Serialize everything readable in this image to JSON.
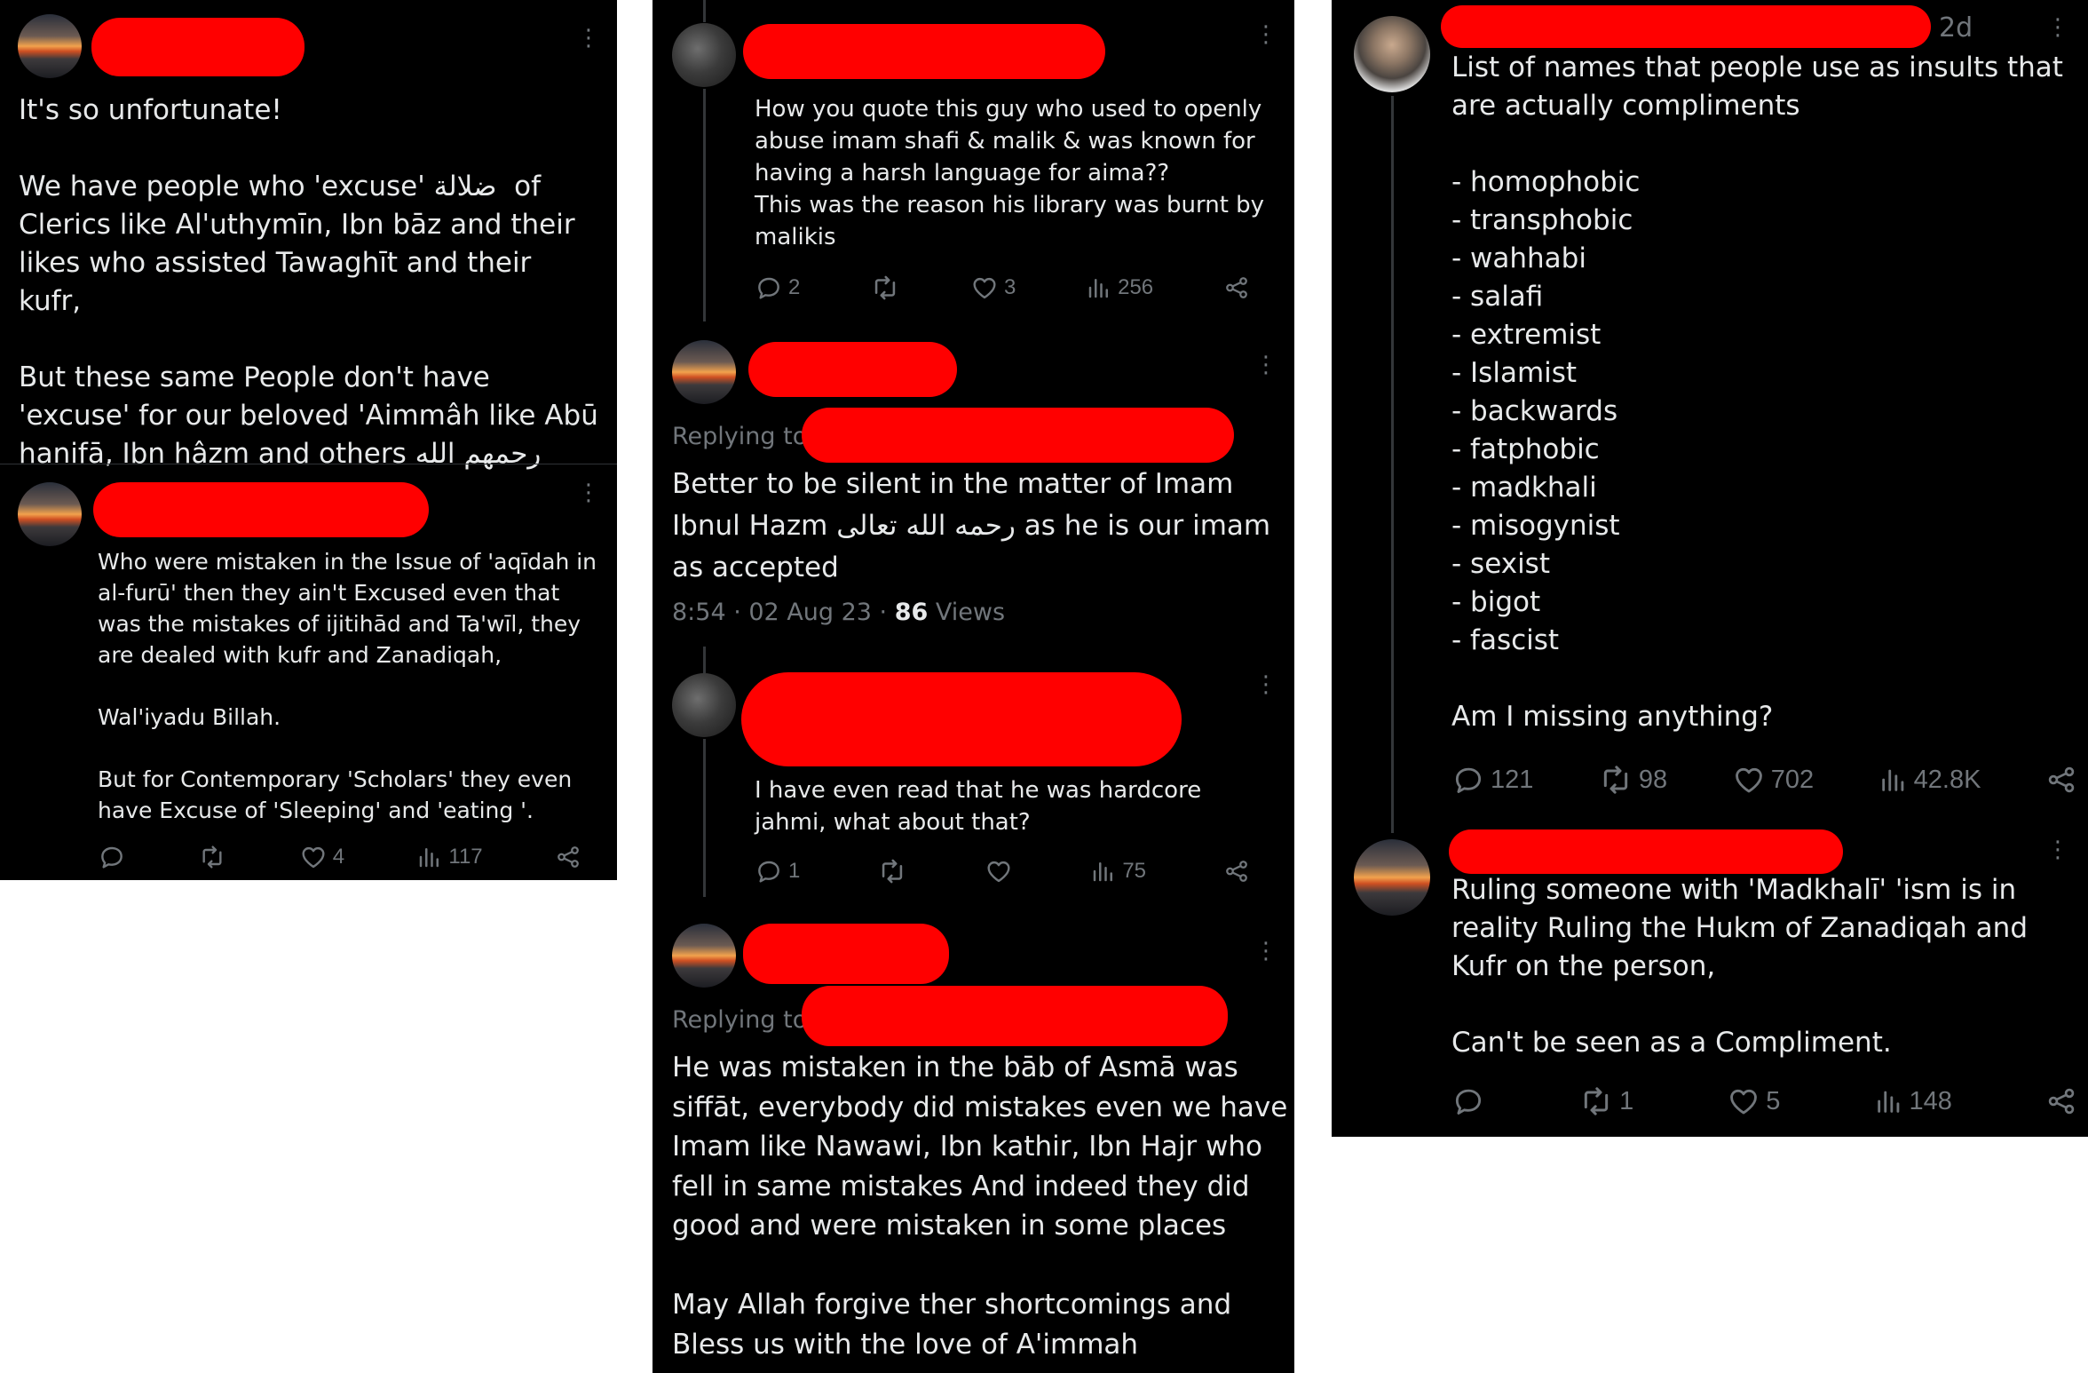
{
  "panel1": {
    "tweet1": {
      "text": "It's so unfortunate!\n\nWe have people who 'excuse' ضلالة  of Clerics like Al'uthymīn, Ibn bāz and their likes who assisted Tawaghīt and their kufr,\n\nBut these same People don't have 'excuse' for our beloved 'Aimmâh like Abū hanifā, Ibn hâzm and others رحمهم الله"
    },
    "tweet2": {
      "text": "Who were mistaken in the Issue of 'aqīdah in al-furū' then they ain't Excused even that was the mistakes of ijitihād and Ta'wīl, they are dealed with kufr and Zanadiqah,\n\nWal'iyadu Billah.\n\nBut for Contemporary 'Scholars' they even have Excuse of 'Sleeping' and 'eating '.",
      "likes": "4",
      "views": "117"
    }
  },
  "panel2": {
    "reply1": {
      "text": "How you quote this guy who used to openly abuse imam shafi & malik & was known for having a harsh language for aima??\nThis was the reason his library was burnt by malikis",
      "replies": "2",
      "likes": "3",
      "views": "256"
    },
    "main": {
      "replying_to": "Replying to",
      "text": "Better to be silent in the matter of Imam Ibnul Hazm رحمه الله تعالى as he is our imam as accepted",
      "time": "8:54 · 02 Aug 23 · ",
      "views_count": "86",
      "views_label": " Views"
    },
    "reply2": {
      "text": "I have even read that he was hardcore jahmi, what about that?",
      "replies": "1",
      "views": "75"
    },
    "reply3": {
      "replying_to": "Replying to",
      "text": "He was mistaken in the bāb of Asmā was siffāt, everybody did mistakes even we have Imam like Nawawi, Ibn kathir, Ibn Hajr who fell in same mistakes And indeed they did good and were mistaken in some places\n\nMay Allah forgive ther shortcomings and Bless us with the love of A'immah"
    }
  },
  "panel3": {
    "tweet1": {
      "time": "2d",
      "text": "List of names that people use as insults that are actually compliments\n\n- homophobic\n- transphobic\n- wahhabi\n- salafi\n- extremist\n- Islamist\n- backwards\n- fatphobic\n- madkhali\n- misogynist\n- sexist\n- bigot\n- fascist\n\nAm I missing anything?",
      "replies": "121",
      "reposts": "98",
      "likes": "702",
      "views": "42.8K"
    },
    "tweet2": {
      "text": "Ruling someone with 'Madkhalī' 'ism is in reality Ruling the Hukm of Zanadiqah and Kufr on the person,\n\nCan't be seen as a Compliment.",
      "reposts": "1",
      "likes": "5",
      "views": "148"
    }
  },
  "icons": [
    "reply-icon",
    "repost-icon",
    "like-icon",
    "views-icon",
    "share-icon",
    "more-icon"
  ],
  "colors": {
    "background": "#000000",
    "text": "#e7e9ea",
    "muted": "#71767b",
    "redaction": "#ff0000"
  }
}
